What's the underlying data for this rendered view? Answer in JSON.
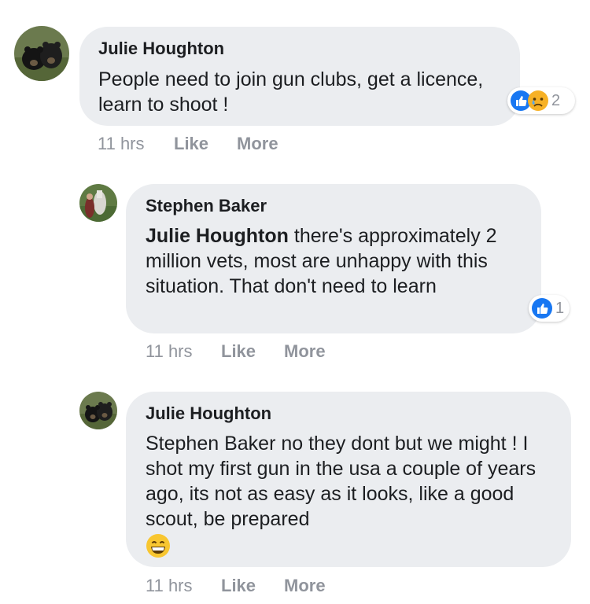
{
  "comments": [
    {
      "author": "Julie Houghton",
      "text": "People need to join gun clubs, get a licence, learn to shoot !",
      "reactions": [
        "like-icon",
        "sad-icon"
      ],
      "reaction_count": "2",
      "time": "11 hrs",
      "like_label": "Like",
      "more_label": "More"
    },
    {
      "author": "Stephen Baker",
      "mention": "Julie Houghton",
      "text": " there's approximately 2 million vets, most are unhappy with this situation. That don't need to learn",
      "reactions": [
        "like-icon"
      ],
      "reaction_count": "1",
      "time": "11 hrs",
      "like_label": "Like",
      "more_label": "More"
    },
    {
      "author": "Julie Houghton",
      "text": "Stephen Baker no they dont but we might ! I shot my first gun in the usa a couple of years ago, its not as easy as it looks, like a good scout, be prepared",
      "emoji": "grinning-face-icon",
      "time": "11 hrs",
      "like_label": "Like",
      "more_label": "More"
    }
  ],
  "colors": {
    "bubble": "#ebedf0",
    "meta_text": "#90949c",
    "like_blue": "#1877f2",
    "sad_yellow": "#f7b125"
  }
}
